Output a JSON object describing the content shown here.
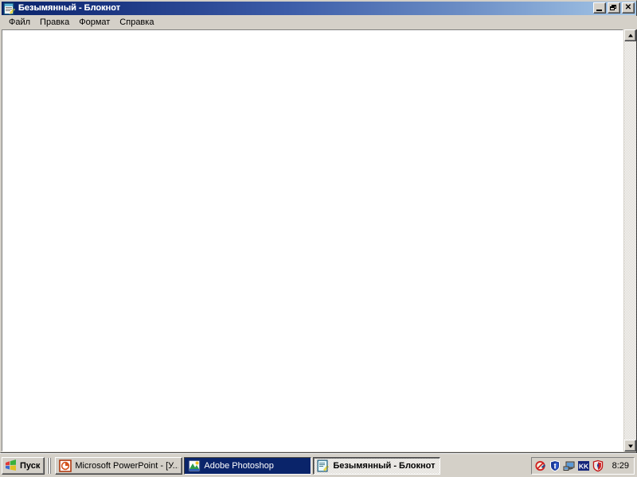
{
  "window": {
    "title": "Безымянный - Блокнот",
    "icon": "notepad-icon",
    "controls": {
      "minimize_label": "_",
      "restore_label": "",
      "close_label": "✕"
    },
    "menu": [
      {
        "label": "Файл"
      },
      {
        "label": "Правка"
      },
      {
        "label": "Формат"
      },
      {
        "label": "Справка"
      }
    ],
    "editor": {
      "content": "",
      "placeholder": ""
    },
    "scrollbar": {
      "up_arrow": "scroll-up-arrow",
      "down_arrow": "scroll-down-arrow"
    }
  },
  "taskbar": {
    "start": {
      "label": "Пуск",
      "icon": "windows-flag-icon"
    },
    "buttons": [
      {
        "label": "Microsoft PowerPoint - [У...",
        "icon": "powerpoint-icon",
        "state": "normal"
      },
      {
        "label": "Adobe Photoshop",
        "icon": "photoshop-icon",
        "state": "active"
      },
      {
        "label": "Безымянный - Блокнот",
        "icon": "notepad-icon",
        "state": "pressed"
      }
    ],
    "tray": {
      "icons": [
        {
          "name": "blocked-icon"
        },
        {
          "name": "shield-blue-icon"
        },
        {
          "name": "network-computer-icon"
        },
        {
          "name": "kk-icon",
          "label": "KK"
        },
        {
          "name": "antivirus-shield-icon"
        }
      ],
      "clock": "8:29"
    }
  },
  "colors": {
    "titlebar_start": "#0a246a",
    "titlebar_end": "#a6c8e8",
    "face": "#d4d0c8",
    "active_task": "#0a246a",
    "editor_bg": "#ffffff"
  }
}
